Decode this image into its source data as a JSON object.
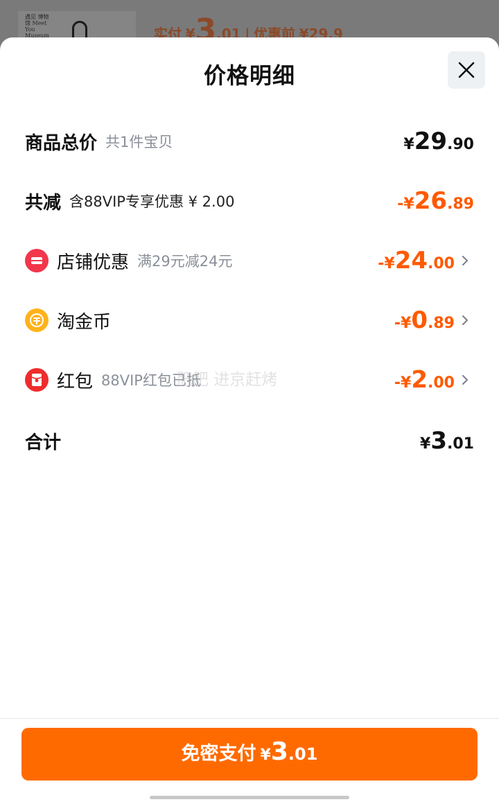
{
  "background": {
    "logo_text": "遇见 博物馆 Meet You Museum",
    "price_prefix": "实付",
    "yen": "¥",
    "price_int": "3",
    "price_dec": ".01",
    "separator": "|",
    "original_label": "优惠前",
    "original_price": "¥29.9"
  },
  "sheet": {
    "title": "价格明细",
    "close_icon": "close-icon"
  },
  "rows": {
    "total": {
      "label": "商品总价",
      "note": "共1件宝贝",
      "sign": "",
      "yen": "¥",
      "int": "29",
      "dec": ".90"
    },
    "reduced": {
      "label": "共减",
      "note": "含88VIP专享优惠 ¥ 2.00",
      "sign": "-",
      "yen": "¥",
      "int": "26",
      "dec": ".89"
    },
    "store": {
      "icon": "store-icon",
      "label": "店铺优惠",
      "note": "满29元减24元",
      "sign": "-",
      "yen": "¥",
      "int": "24",
      "dec": ".00"
    },
    "coins": {
      "icon": "coin-icon",
      "label": "淘金币",
      "note": "",
      "sign": "-",
      "yen": "¥",
      "int": "0",
      "dec": ".89"
    },
    "redpacket": {
      "icon": "red-packet-icon",
      "label": "红包",
      "note": "88VIP红包已抵",
      "sign": "-",
      "yen": "¥",
      "int": "2",
      "dec": ".00"
    },
    "sum": {
      "label": "合计",
      "yen": "¥",
      "int": "3",
      "dec": ".01"
    }
  },
  "watermark": "肥肥 进京赶烤",
  "pay_button": {
    "label": "免密支付",
    "yen": "¥",
    "int": "3",
    "dec": ".01"
  },
  "colors": {
    "accent_orange": "#ff5a00",
    "button_orange": "#ff6a00",
    "store_red": "#f2364b",
    "coin_gold": "#ffb31a",
    "packet_red": "#ee2d2d"
  }
}
